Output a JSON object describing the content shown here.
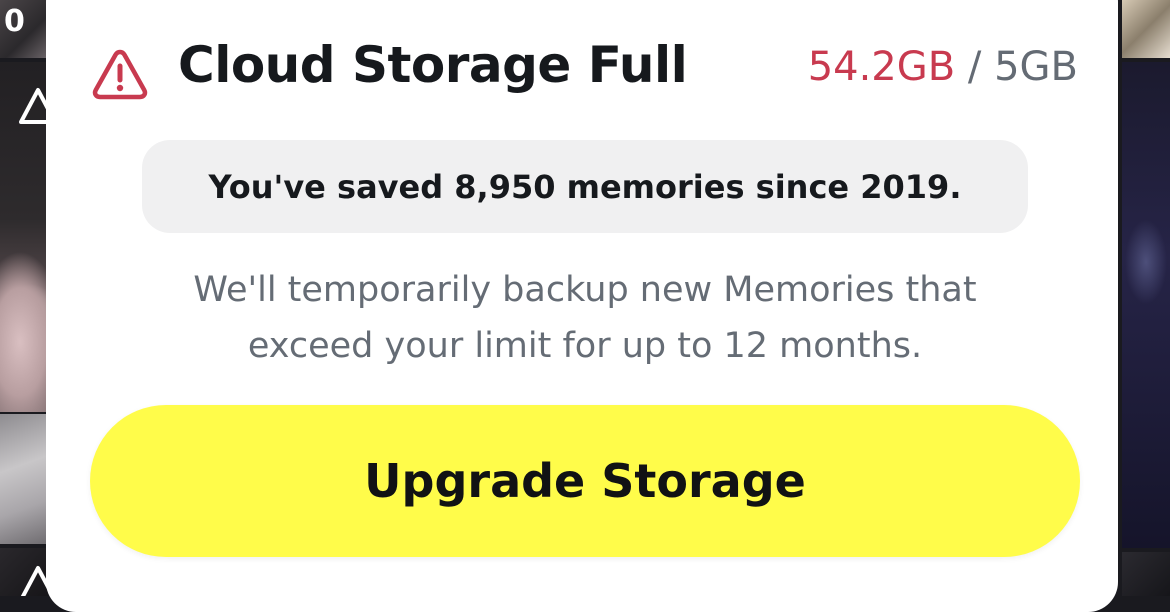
{
  "background": {
    "time_fragment": "0",
    "icons": [
      "warning-icon",
      "warning-icon"
    ]
  },
  "dialog": {
    "icon": "warning-triangle-icon",
    "title": "Cloud Storage Full",
    "usage": {
      "used": "54.2GB",
      "separator": "/",
      "limit": "5GB"
    },
    "stat_text": "You've saved 8,950 memories since 2019.",
    "description_lines": [
      "We'll temporarily backup new Memories that",
      "exceed your limit for up to 12 months."
    ],
    "upgrade_button_label": "Upgrade Storage"
  },
  "colors": {
    "accent_yellow": "#FFFC4A",
    "usage_red": "#C83A4F",
    "warning_icon": "#C83A4F",
    "text_dark": "#16191D",
    "text_muted": "#656C75",
    "pill_bg": "#F0F0F1"
  }
}
